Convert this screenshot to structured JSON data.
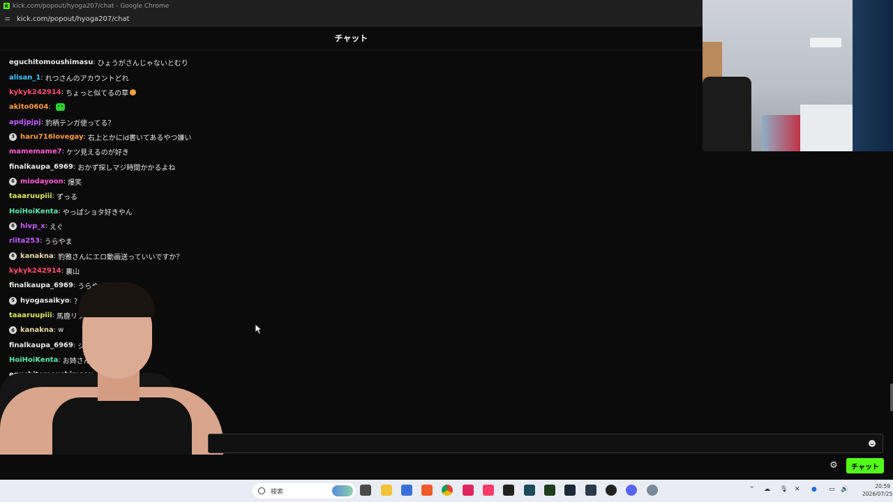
{
  "browser": {
    "window_title": "kick.com/popout/hyoga207/chat - Google Chrome",
    "favicon_letter": "K",
    "url": "kick.com/popout/hyoga207/chat"
  },
  "chat": {
    "header_title": "チャット",
    "messages": [
      {
        "user": "eguchitomoushimasu",
        "color": "#e8e8e8",
        "text": "ひょうがさんじゃないとむり"
      },
      {
        "user": "alisan_1",
        "color": "#3ec7ff",
        "text": "れつさんのアカウントどれ"
      },
      {
        "user": "kykyk242914",
        "color": "#ff4d6d",
        "text": "ちょっと似てるの草"
      },
      {
        "user": "akito0604",
        "color": "#ff9a3c",
        "text": ""
      },
      {
        "user": "apdjpjpj",
        "color": "#c45cff",
        "text": "豹柄テンガ使ってる？"
      },
      {
        "user": "haru716lovegay",
        "badge": "3",
        "color": "#ff9a3c",
        "text": "右上とかにid書いてあるやつ嫌い"
      },
      {
        "user": "mamemame7",
        "color": "#ff5ad2",
        "text": "ケツ見えるのが好き"
      },
      {
        "user": "finalkaupa_6969",
        "color": "#e8e8e8",
        "text": "おかず探しマジ時間かかるよね"
      },
      {
        "user": "miodayoon",
        "badge": "6",
        "color": "#ff5ad2",
        "text": "爆笑"
      },
      {
        "user": "taaaruupiii",
        "color": "#d9e85a",
        "text": "ずっる"
      },
      {
        "user": "HoiHoiKenta",
        "color": "#5de8b0",
        "text": "やっぱショタ好きやん"
      },
      {
        "user": "hivp_x",
        "badge": "6",
        "color": "#c45cff",
        "text": "えぐ"
      },
      {
        "user": "riita253",
        "color": "#c45cff",
        "text": "うらやま"
      },
      {
        "user": "kanakna",
        "badge": "6",
        "color": "#e8d9a0",
        "text": "豹雅さんにエロ動画送っていいですか？"
      },
      {
        "user": "kykyk242914",
        "color": "#ff4d6d",
        "text": "裏山"
      },
      {
        "user": "finalkaupa_6969",
        "color": "#e8e8e8",
        "text": "うらやま"
      },
      {
        "user": "hyogasaikyo",
        "badge": "5",
        "color": "#e8e8e8",
        "text": "？"
      },
      {
        "user": "taaaruupiii",
        "color": "#d9e85a",
        "text": "馬鹿リフ"
      },
      {
        "user": "kanakna",
        "badge": "6",
        "color": "#e8d9a0",
        "text": "w"
      },
      {
        "user": "finalkaupa_6969",
        "color": "#e8e8e8",
        "text": "ジ"
      },
      {
        "user": "HoiHoiKenta",
        "color": "#5de8b0",
        "text": "お姉さん"
      },
      {
        "user": "eguchitomoushimasu",
        "color": "#e8e8e8",
        "text": ""
      }
    ],
    "input_value": "",
    "send_label": "チャット"
  },
  "taskbar": {
    "search_placeholder": "検索",
    "time": "20:59",
    "date": "2026/07/25"
  },
  "colors": {
    "kick_green": "#53fc18",
    "background": "#0b0b0c"
  },
  "icons": [
    "site-info-icon",
    "gear-icon",
    "emoji-icon",
    "search-icon",
    "mouse-cursor-icon"
  ]
}
